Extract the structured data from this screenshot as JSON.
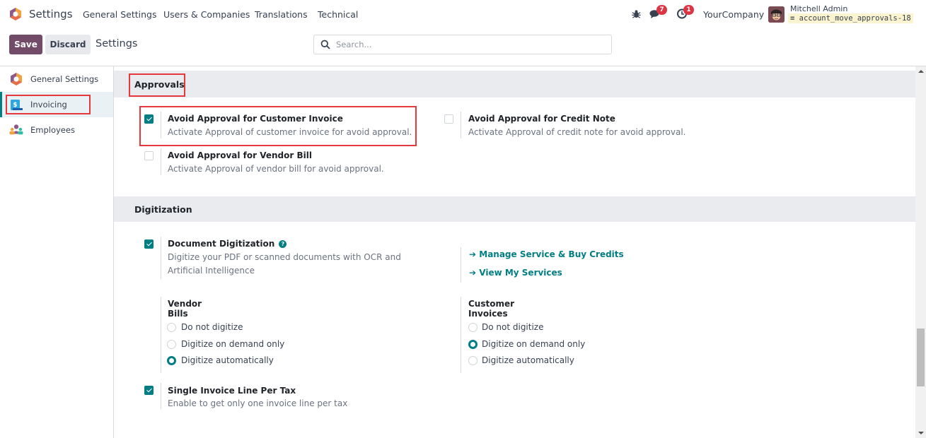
{
  "app": {
    "title": "Settings",
    "menu": [
      "General Settings",
      "Users & Companies",
      "Translations",
      "Technical"
    ]
  },
  "systray": {
    "bug_icon": "bug-icon",
    "messages_count": "7",
    "activities_count": "1",
    "company": "YourCompany",
    "user_name": "Mitchell Admin",
    "database": "account_move_approvals-18"
  },
  "control_panel": {
    "save_label": "Save",
    "discard_label": "Discard",
    "breadcrumb": "Settings",
    "search_placeholder": "Search..."
  },
  "sidebar": {
    "items": [
      {
        "label": "General Settings",
        "icon": "odoo-logo-icon",
        "active": false
      },
      {
        "label": "Invoicing",
        "icon": "invoicing-icon",
        "active": true
      },
      {
        "label": "Employees",
        "icon": "employees-icon",
        "active": false
      }
    ]
  },
  "sections": {
    "approvals": {
      "title": "Approvals",
      "settings": [
        {
          "title": "Avoid Approval for Customer Invoice",
          "description": "Activate Approval of customer invoice for avoid approval.",
          "checked": true
        },
        {
          "title": "Avoid Approval for Credit Note",
          "description": "Activate Approval of credit note for avoid approval.",
          "checked": false
        },
        {
          "title": "Avoid Approval for Vendor Bill",
          "description": "Activate Approval of vendor bill for avoid approval.",
          "checked": false
        }
      ]
    },
    "digitization": {
      "title": "Digitization",
      "document": {
        "title": "Document Digitization",
        "description": "Digitize your PDF or scanned documents with OCR and Artificial Intelligence",
        "checked": true,
        "help": "?"
      },
      "links": [
        "Manage Service & Buy Credits",
        "View My Services"
      ],
      "link_arrow": "➔",
      "vendor_bills": {
        "title": "Vendor Bills",
        "options": [
          "Do not digitize",
          "Digitize on demand only",
          "Digitize automatically"
        ],
        "selected": "Digitize automatically"
      },
      "customer_invoices": {
        "title": "Customer Invoices",
        "options": [
          "Do not digitize",
          "Digitize on demand only",
          "Digitize automatically"
        ],
        "selected": "Digitize on demand only"
      },
      "single_line": {
        "title": "Single Invoice Line Per Tax",
        "description": "Enable to get only one invoice line per tax",
        "checked": true
      }
    }
  },
  "colors": {
    "brand": "#714b67",
    "accent": "#017e84",
    "highlight": "#e5393d"
  }
}
